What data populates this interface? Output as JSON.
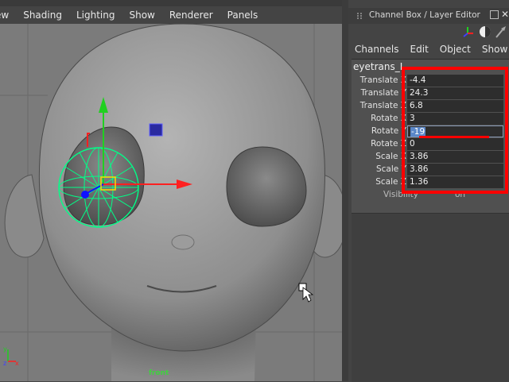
{
  "viewport": {
    "menus": [
      "ew",
      "Shading",
      "Lighting",
      "Show",
      "Renderer",
      "Panels"
    ],
    "camera_label": "front",
    "axis_labels": {
      "x": "x",
      "y": "y",
      "z": "z"
    }
  },
  "channel_box": {
    "title": "Channel Box / Layer Editor",
    "menus": [
      "Channels",
      "Edit",
      "Object",
      "Show"
    ],
    "object_name": "eyetrans_L",
    "attributes": [
      {
        "label": "Translate X",
        "value": "-4.4"
      },
      {
        "label": "Translate Y",
        "value": "24.3"
      },
      {
        "label": "Translate Z",
        "value": "6.8"
      },
      {
        "label": "Rotate X",
        "value": "3"
      },
      {
        "label": "Rotate Y",
        "value": "-19",
        "editing": true
      },
      {
        "label": "Rotate Z",
        "value": "0"
      },
      {
        "label": "Scale X",
        "value": "3.86"
      },
      {
        "label": "Scale Y",
        "value": "3.86"
      },
      {
        "label": "Scale Z",
        "value": "1.36"
      }
    ],
    "visibility": {
      "label": "Visibility",
      "value": "on"
    }
  },
  "colors": {
    "annotation_red": "#ff0000",
    "manip_green": "#00ff88",
    "axis_x": "#ff2020",
    "axis_y": "#20d020",
    "axis_z": "#1010ff",
    "camera_label": "#3fd23f"
  }
}
